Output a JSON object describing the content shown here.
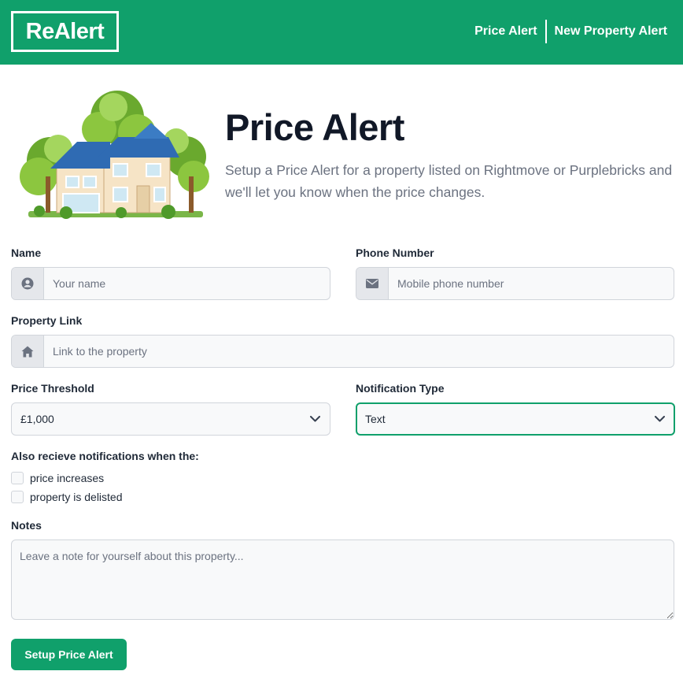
{
  "brand": {
    "logo_text": "ReAlert",
    "color": "#10a06b"
  },
  "nav": {
    "items": [
      {
        "label": "Price Alert"
      },
      {
        "label": "New Property Alert"
      }
    ]
  },
  "hero": {
    "title": "Price Alert",
    "description": "Setup a Price Alert for a property listed on Rightmove or Purplebricks and we'll let you know when the price changes.",
    "illustration": "house-illustration"
  },
  "form": {
    "name": {
      "label": "Name",
      "placeholder": "Your name",
      "icon": "user-circle-icon"
    },
    "phone": {
      "label": "Phone Number",
      "placeholder": "Mobile phone number",
      "icon": "envelope-icon"
    },
    "property_link": {
      "label": "Property Link",
      "placeholder": "Link to the property",
      "icon": "home-icon"
    },
    "price_threshold": {
      "label": "Price Threshold",
      "value": "£1,000"
    },
    "notification_type": {
      "label": "Notification Type",
      "value": "Text"
    },
    "also_notify": {
      "label": "Also recieve notifications when the:",
      "options": [
        {
          "label": "price increases",
          "checked": false
        },
        {
          "label": "property is delisted",
          "checked": false
        }
      ]
    },
    "notes": {
      "label": "Notes",
      "placeholder": "Leave a note for yourself about this property..."
    },
    "submit_label": "Setup Price Alert"
  }
}
